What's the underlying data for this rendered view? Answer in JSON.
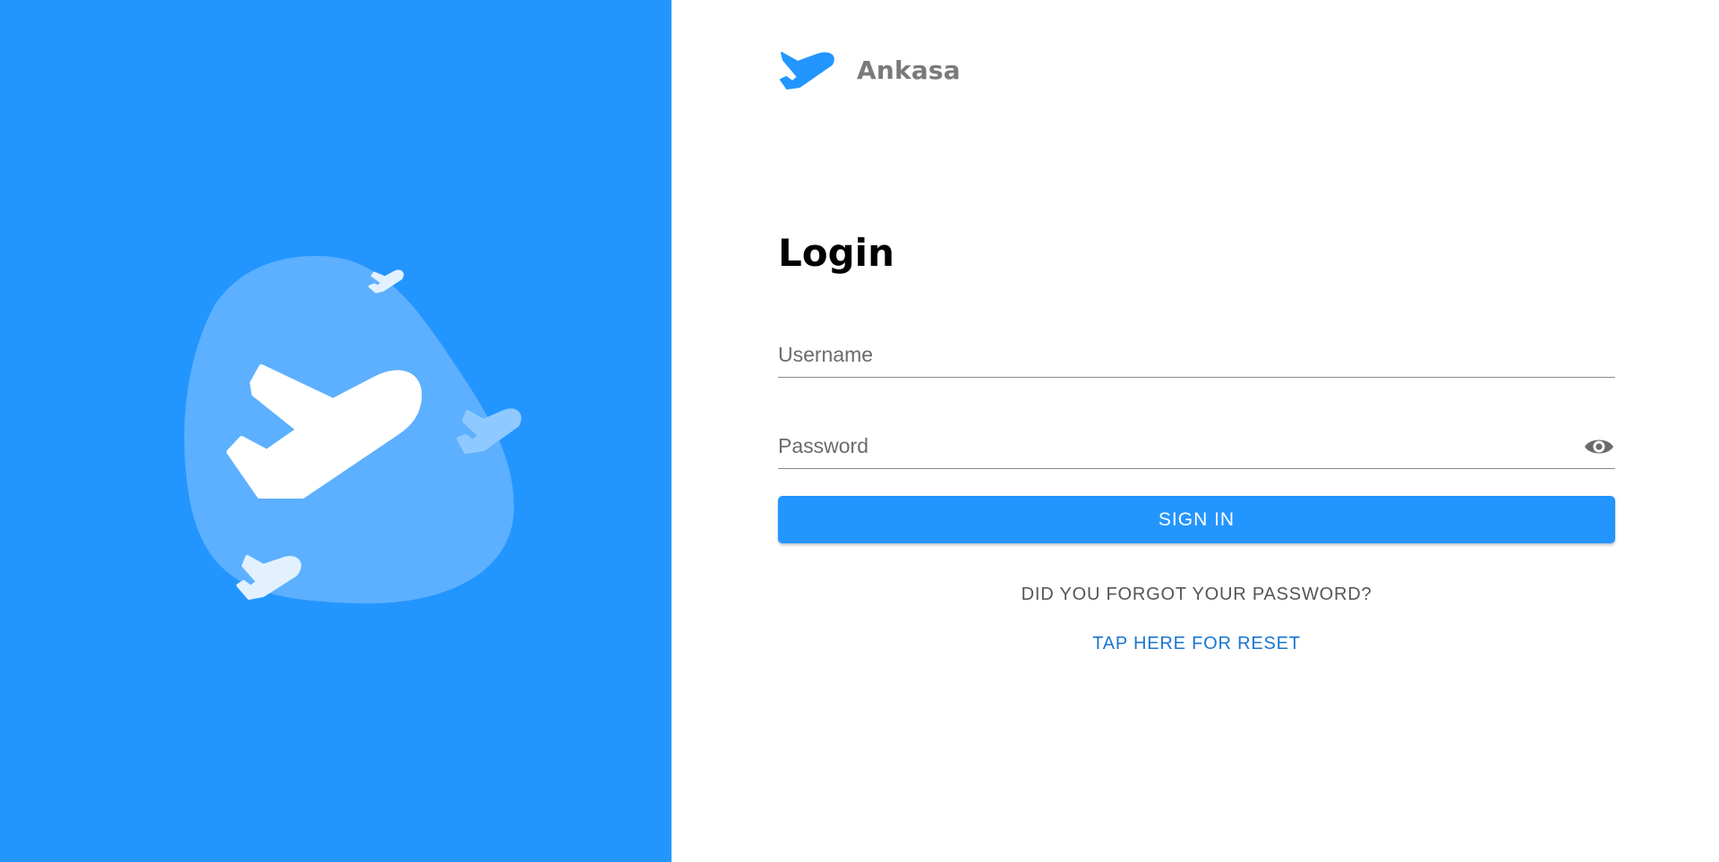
{
  "brand": {
    "name": "Ankasa",
    "logo_icon": "plane-icon"
  },
  "hero": {
    "illustration": "airplanes-blob-illustration",
    "background_color": "#2395ff"
  },
  "form": {
    "title": "Login",
    "username": {
      "placeholder": "Username",
      "value": ""
    },
    "password": {
      "placeholder": "Password",
      "value": "",
      "visibility_icon": "eye-icon"
    },
    "submit_label": "SIGN IN",
    "forgot_text": "DID YOU FORGOT YOUR PASSWORD?",
    "reset_link": "TAP HERE FOR RESET"
  },
  "colors": {
    "accent": "#2395ff",
    "link": "#1976d2"
  }
}
